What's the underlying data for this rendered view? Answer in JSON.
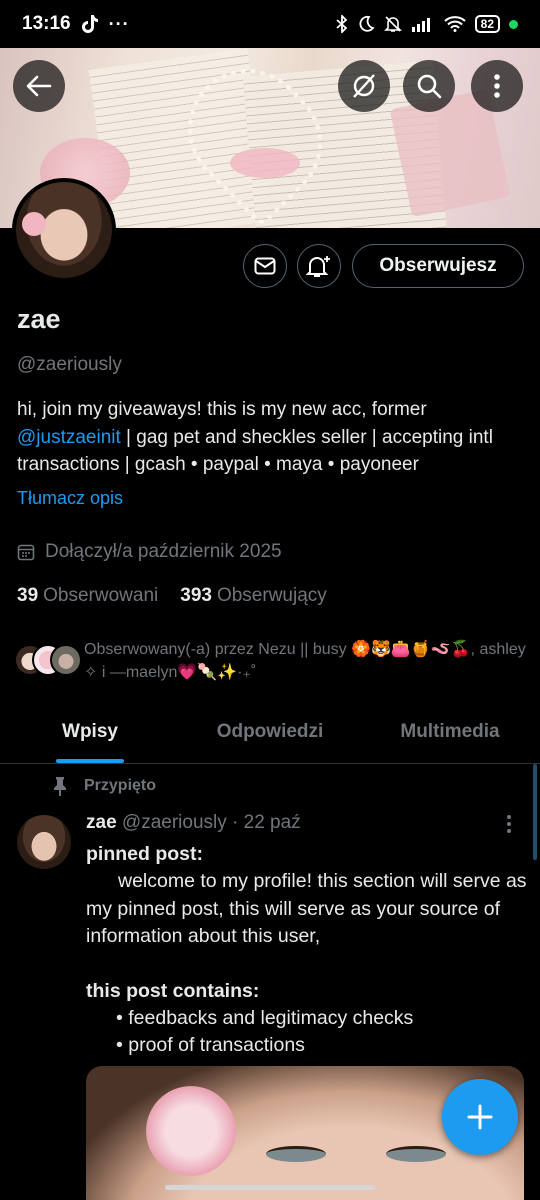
{
  "status_bar": {
    "time": "13:16",
    "battery": "82",
    "extra_icons": [
      "tiktok-icon",
      "more-dots-icon",
      "bluetooth-icon",
      "moon-icon",
      "mute-icon",
      "signal-icon",
      "wifi-icon"
    ]
  },
  "profile": {
    "name": "zae",
    "handle": "@zaeriously",
    "bio_before": "hi, join my giveaways! this is my new acc, former ",
    "bio_mention": "@justzaeinit",
    "bio_after": " | gag pet and sheckles seller | accepting intl transactions | gcash • paypal • maya • payoneer",
    "translate_label": "Tłumacz opis",
    "joined": "Dołączył/a październik 2025",
    "following_count": "39",
    "following_label": "Obserwowani",
    "followers_count": "393",
    "followers_label": "Obserwujący",
    "followed_by": "Obserwowany(-a) przez Nezu || busy 🏵️🐯👛🍯🪱🍒, ashley ✧ i —maelyn💗🍡✨·₊˚",
    "follow_button": "Obserwujesz"
  },
  "tabs": [
    {
      "label": "Wpisy",
      "active": true
    },
    {
      "label": "Odpowiedzi",
      "active": false
    },
    {
      "label": "Multimedia",
      "active": false
    }
  ],
  "post": {
    "pinned_label": "Przypięto",
    "author_name": "zae",
    "author_meta": "@zaeriously · 22 paź",
    "line1": "pinned post:",
    "line2": "welcome to my profile! this section will serve as my pinned post, this will serve as your source of information about this user,",
    "line3": "this post contains:",
    "bullet1": "• feedbacks and legitimacy checks",
    "bullet2": "• proof of transactions"
  },
  "colors": {
    "accent": "#1d9bf0",
    "background": "#000000",
    "muted": "#71767b"
  }
}
